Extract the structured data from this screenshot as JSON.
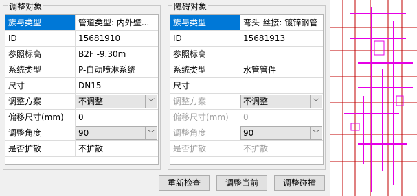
{
  "left_group": {
    "title": "调整对象",
    "rows": [
      {
        "label": "族与类型",
        "value": "管道类型: 内外壁..."
      },
      {
        "label": "ID",
        "value": "15681910"
      },
      {
        "label": "参照标高",
        "value": "B2F -9.30m"
      },
      {
        "label": "系统类型",
        "value": "P-自动喷淋系统"
      },
      {
        "label": "尺寸",
        "value": "DN15"
      },
      {
        "label": "调整方案",
        "value": "不调整"
      },
      {
        "label": "偏移尺寸(mm)",
        "value": "0"
      },
      {
        "label": "调整角度",
        "value": "90"
      },
      {
        "label": "是否扩散",
        "value": "不扩散"
      }
    ]
  },
  "right_group": {
    "title": "障碍对象",
    "rows": [
      {
        "label": "族与类型",
        "value": "弯头-丝接: 镀锌钢管"
      },
      {
        "label": "ID",
        "value": "15681913"
      },
      {
        "label": "参照标高",
        "value": ""
      },
      {
        "label": "系统类型",
        "value": "水管管件"
      },
      {
        "label": "尺寸",
        "value": ""
      },
      {
        "label": "调整方案",
        "value": "不调整"
      },
      {
        "label": "偏移尺寸(mm)",
        "value": "0"
      },
      {
        "label": "调整角度",
        "value": "90"
      },
      {
        "label": "是否扩散",
        "value": "不扩散"
      }
    ]
  },
  "buttons": {
    "recheck": "重新检查",
    "adjust_current": "调整当前",
    "adjust_collision": "调整碰撞"
  },
  "colors": {
    "selection": "#0078d7",
    "cad_magenta": "#e600e6",
    "cad_red": "#c00000"
  }
}
